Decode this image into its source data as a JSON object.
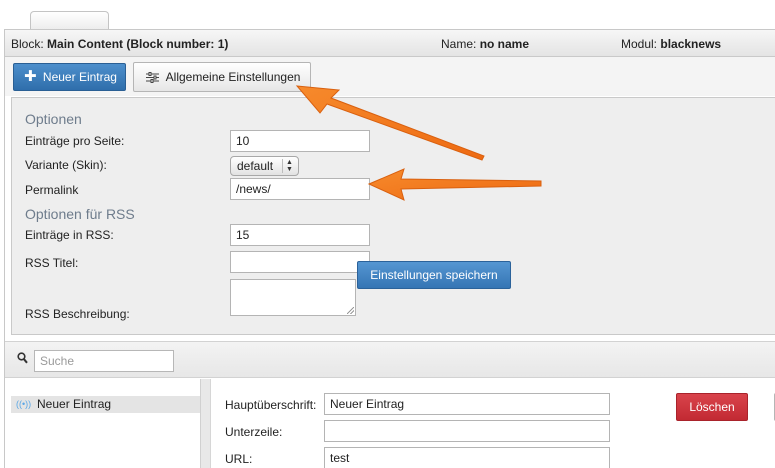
{
  "infobar": {
    "block_label": "Block:",
    "block_value": "Main Content (Block number: 1)",
    "name_label": "Name:",
    "name_value": "no name",
    "modul_label": "Modul:",
    "modul_value": "blacknews"
  },
  "toolbar": {
    "new_entry_label": "Neuer Eintrag",
    "settings_label": "Allgemeine Einstellungen"
  },
  "options": {
    "title": "Optionen",
    "entries_per_page_label": "Einträge pro Seite:",
    "entries_per_page_value": "10",
    "variant_label": "Variante (Skin):",
    "variant_value": "default",
    "permalink_label": "Permalink",
    "permalink_value": "/news/",
    "rss_title": "Optionen für RSS",
    "rss_entries_label": "Einträge in RSS:",
    "rss_entries_value": "15",
    "rss_title_label": "RSS Titel:",
    "rss_title_value": "",
    "rss_description_label": "RSS Beschreibung:",
    "rss_description_value": "",
    "save_label": "Einstellungen speichern"
  },
  "search": {
    "placeholder": "Suche"
  },
  "list": {
    "items": [
      {
        "label": "Neuer Eintrag"
      }
    ]
  },
  "detail": {
    "headline_label": "Hauptüberschrift:",
    "headline_value": "Neuer Eintrag",
    "subline_label": "Unterzeile:",
    "subline_value": "",
    "url_label": "URL:",
    "url_value": "test",
    "delete_label": "Löschen"
  },
  "colors": {
    "primary_blue": "#3a7bbf",
    "delete_red": "#cf3139",
    "annotation_orange": "#f47b20",
    "section_title": "#6e7c8c"
  },
  "icons": {
    "new_entry": "plus-icon",
    "settings": "sliders-icon",
    "search": "search-icon",
    "list_item": "rss-icon"
  }
}
